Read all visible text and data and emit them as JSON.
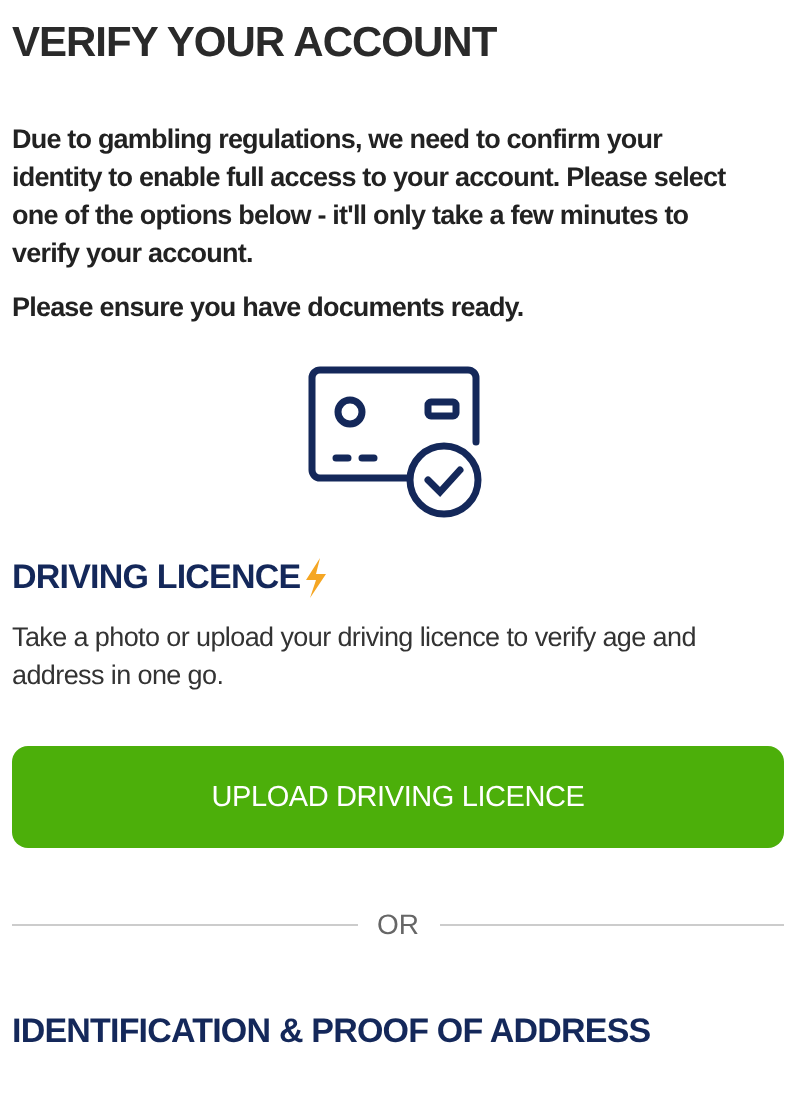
{
  "title": "VERIFY YOUR ACCOUNT",
  "intro": "Due to gambling regulations, we need to confirm your identity to enable full access to your account. Please select one of the options below - it'll only take a few minutes to verify your account.",
  "note": "Please ensure you have documents ready.",
  "options": [
    {
      "heading": "DRIVING LICENCE",
      "fast": true,
      "description": "Take a photo or upload your driving licence to verify age and address in one go.",
      "button": "UPLOAD DRIVING LICENCE"
    },
    {
      "heading": "IDENTIFICATION & PROOF OF ADDRESS",
      "fast": false
    }
  ],
  "separator": "OR"
}
